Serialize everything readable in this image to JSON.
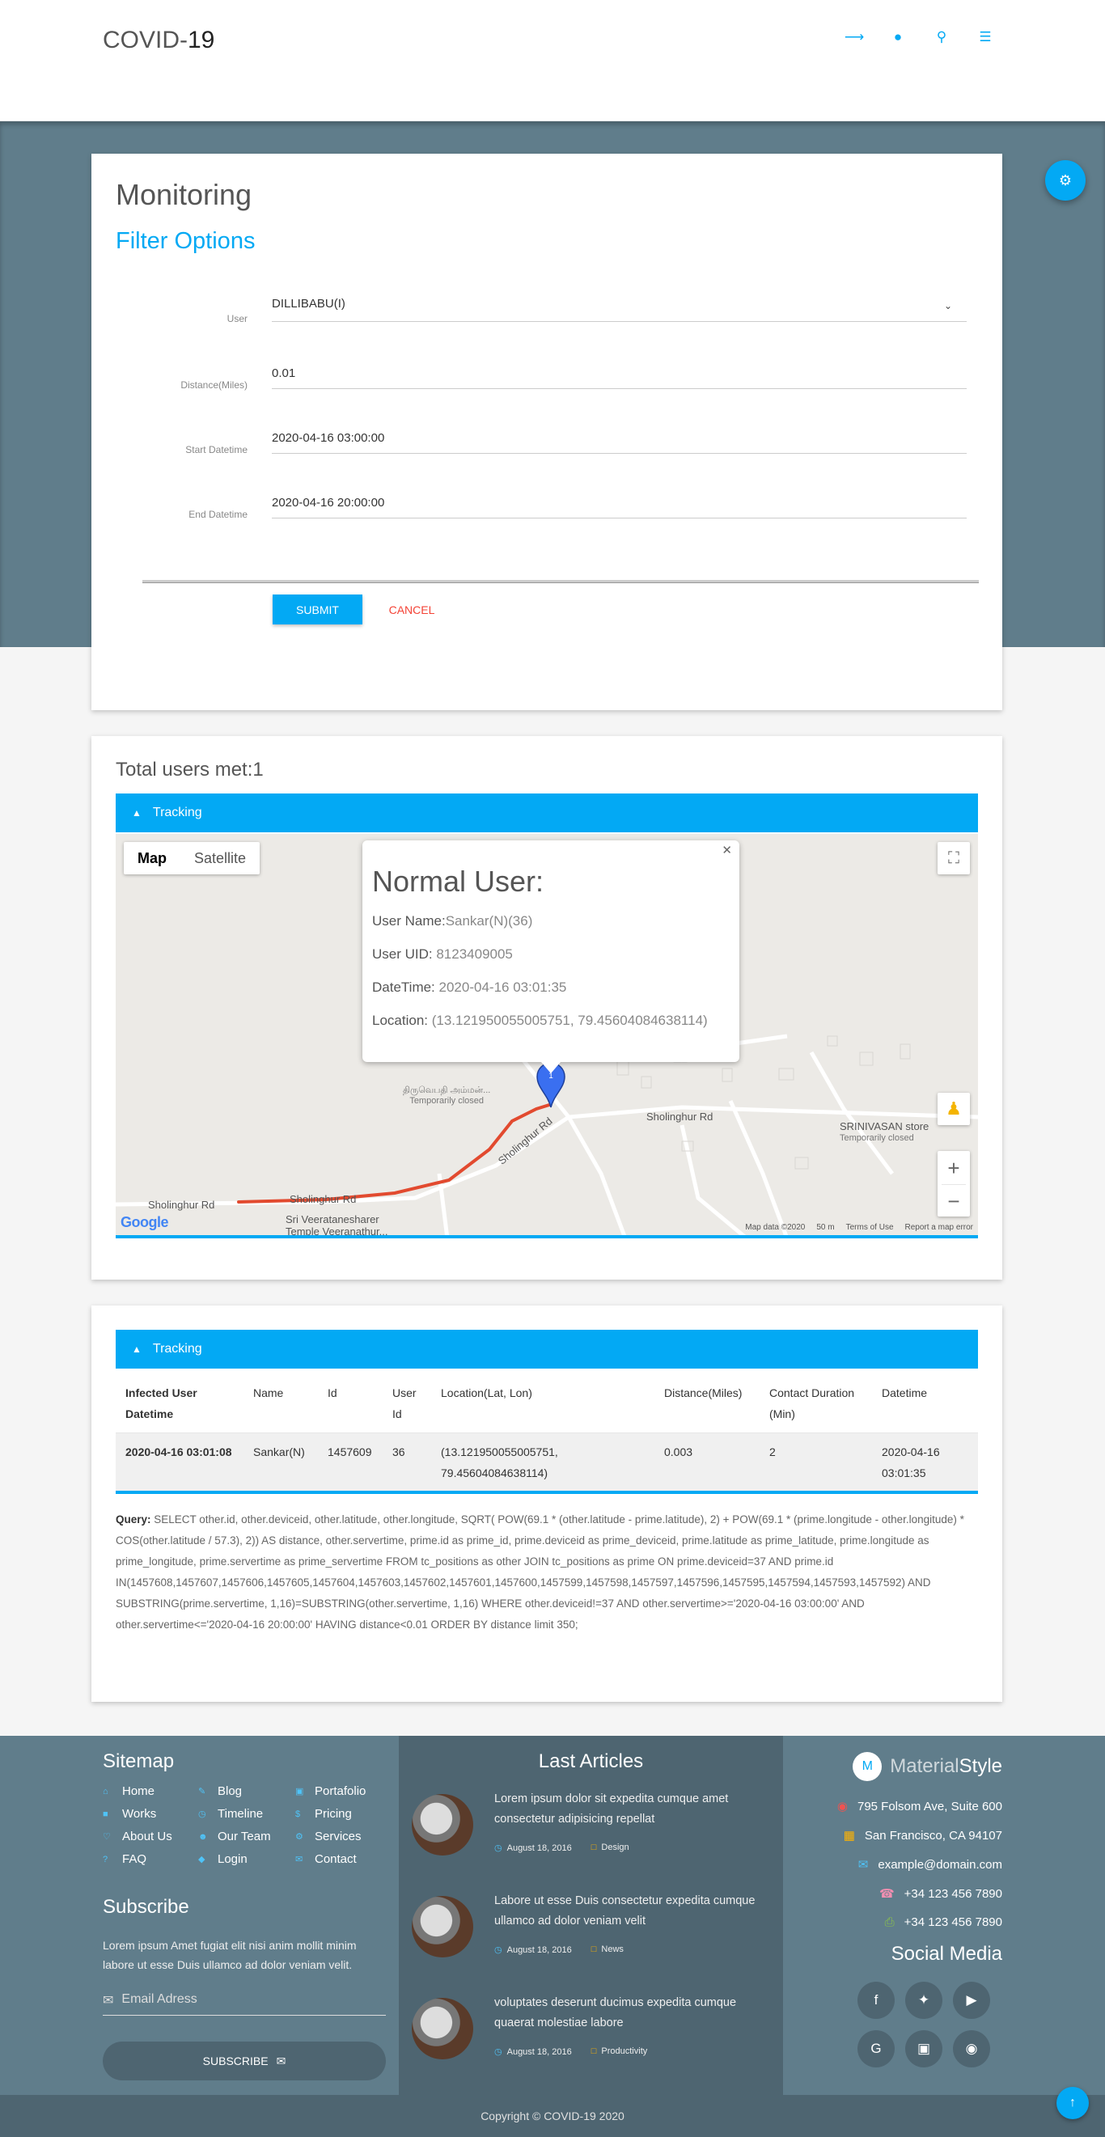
{
  "header": {
    "brand_prefix": "COVID-",
    "brand_suffix": "19",
    "icons": [
      "share-icon",
      "user-icon",
      "search-icon",
      "menu-icon"
    ]
  },
  "monitoring": {
    "title": "Monitoring",
    "subtitle": "Filter Options",
    "fields": [
      {
        "label": "User",
        "value": "DILLIBABU(I)"
      },
      {
        "label": "Distance(Miles)",
        "value": "0.01"
      },
      {
        "label": "Start Datetime",
        "value": "2020-04-16 03:00:00"
      },
      {
        "label": "End Datetime",
        "value": "2020-04-16 20:00:00"
      }
    ],
    "submit_label": "SUBMIT",
    "cancel_label": "CANCEL"
  },
  "map_section": {
    "total": "Total users met:1",
    "bar_title": "Tracking",
    "map_type": {
      "map": "Map",
      "satellite": "Satellite"
    },
    "popup": {
      "title": "Normal User:",
      "user_name_label": "User Name:",
      "user_name": "Sankar(N)(36)",
      "uid_label": "User UID: ",
      "uid": "8123409005",
      "datetime_label": "DateTime: ",
      "datetime": "2020-04-16 03:01:35",
      "location_label": "Location: ",
      "location": "(13.121950055005751, 79.45604084638114)"
    },
    "marker_label": "1",
    "roads": [
      "Sholinghur Rd",
      "Sholinghur Rd",
      "Sholinghur Rd",
      "Sholinghur Rd"
    ],
    "pois": [
      {
        "name": "திருவெபதி அம்மன்...",
        "sub": "Temporarily closed"
      },
      {
        "name": "SRINIVASAN store",
        "sub": "Temporarily closed"
      },
      {
        "name": "Sri Veeratanesharer",
        "sub": "Temple Veeranathur..."
      }
    ],
    "footer": {
      "data": "Map data ©2020",
      "scale": "50 m",
      "terms": "Terms of Use",
      "report": "Report a map error"
    },
    "google": "Google"
  },
  "table_section": {
    "bar_title": "Tracking",
    "headers": [
      "Infected User Datetime",
      "Name",
      "Id",
      "User Id",
      "Location(Lat, Lon)",
      "Distance(Miles)",
      "Contact Duration (Min)",
      "Datetime"
    ],
    "rows": [
      [
        "2020-04-16 03:01:08",
        "Sankar(N)",
        "1457609",
        "36",
        "(13.121950055005751, 79.45604084638114)",
        "0.003",
        "2",
        "2020-04-16 03:01:35"
      ]
    ],
    "query_label": "Query:",
    "query": " SELECT other.id, other.deviceid, other.latitude, other.longitude, SQRT( POW(69.1 * (other.latitude - prime.latitude), 2) + POW(69.1 * (prime.longitude - other.longitude) * COS(other.latitude / 57.3), 2)) AS distance, other.servertime, prime.id as prime_id, prime.deviceid as prime_deviceid, prime.latitude as prime_latitude, prime.longitude as prime_longitude, prime.servertime as prime_servertime FROM tc_positions as other JOIN tc_positions as prime ON prime.deviceid=37 AND prime.id IN(1457608,1457607,1457606,1457605,1457604,1457603,1457602,1457601,1457600,1457599,1457598,1457597,1457596,1457595,1457594,1457593,1457592) AND SUBSTRING(prime.servertime, 1,16)=SUBSTRING(other.servertime, 1,16) WHERE other.deviceid!=37 AND other.servertime>='2020-04-16 03:00:00' AND other.servertime<='2020-04-16 20:00:00' HAVING distance<0.01 ORDER BY distance limit 350;"
  },
  "footer": {
    "sitemap_title": "Sitemap",
    "sitemap": [
      {
        "label": "Home",
        "icon": "home-icon"
      },
      {
        "label": "Blog",
        "icon": "pencil-icon"
      },
      {
        "label": "Portafolio",
        "icon": "monitor-icon"
      },
      {
        "label": "Works",
        "icon": "briefcase-icon"
      },
      {
        "label": "Timeline",
        "icon": "clock-icon"
      },
      {
        "label": "Pricing",
        "icon": "dollar-icon"
      },
      {
        "label": "About Us",
        "icon": "heart-icon"
      },
      {
        "label": "Our Team",
        "icon": "group-icon"
      },
      {
        "label": "Services",
        "icon": "gears-icon"
      },
      {
        "label": "FAQ",
        "icon": "question-icon"
      },
      {
        "label": "Login",
        "icon": "lock-icon"
      },
      {
        "label": "Contact",
        "icon": "envelope-icon"
      }
    ],
    "subscribe_title": "Subscribe",
    "subscribe_text": "Lorem ipsum Amet fugiat elit nisi anim mollit minim labore ut esse Duis ullamco ad dolor veniam velit.",
    "email_placeholder": "Email Adress",
    "subscribe_button": "SUBSCRIBE",
    "articles_title": "Last Articles",
    "articles": [
      {
        "title": "Lorem ipsum dolor sit expedita cumque amet consectetur adipisicing repellat",
        "date": "August 18, 2016",
        "tag": "Design"
      },
      {
        "title": "Labore ut esse Duis consectetur expedita cumque ullamco ad dolor veniam velit",
        "date": "August 18, 2016",
        "tag": "News"
      },
      {
        "title": "voluptates deserunt ducimus expedita cumque quaerat molestiae labore",
        "date": "August 18, 2016",
        "tag": "Productivity"
      }
    ],
    "brand_logo": "M",
    "brand_a": "Material",
    "brand_b": "Style",
    "contacts": [
      {
        "text": "795 Folsom Ave, Suite 600",
        "icon": "map-marker-icon",
        "color": "#ef5350"
      },
      {
        "text": "San Francisco, CA 94107",
        "icon": "map-icon",
        "color": "#ffb300"
      },
      {
        "text": "example@domain.com",
        "icon": "envelope-icon",
        "color": "#4fc3f7"
      },
      {
        "text": "+34 123 456 7890",
        "icon": "phone-icon",
        "color": "#f48fb1"
      },
      {
        "text": "+34 123 456 7890",
        "icon": "fax-icon",
        "color": "#8bc34a"
      }
    ],
    "social_title": "Social Media",
    "social": [
      "facebook-icon",
      "twitter-icon",
      "youtube-icon",
      "google-icon",
      "instagram-icon",
      "github-icon"
    ],
    "copyright": "Copyright © COVID-19 2020"
  },
  "colors": {
    "accent": "#03a9f4",
    "hero": "#607d8b",
    "footer_dark": "#4e6571",
    "cancel": "#f44336",
    "route": "#e24a2f"
  }
}
